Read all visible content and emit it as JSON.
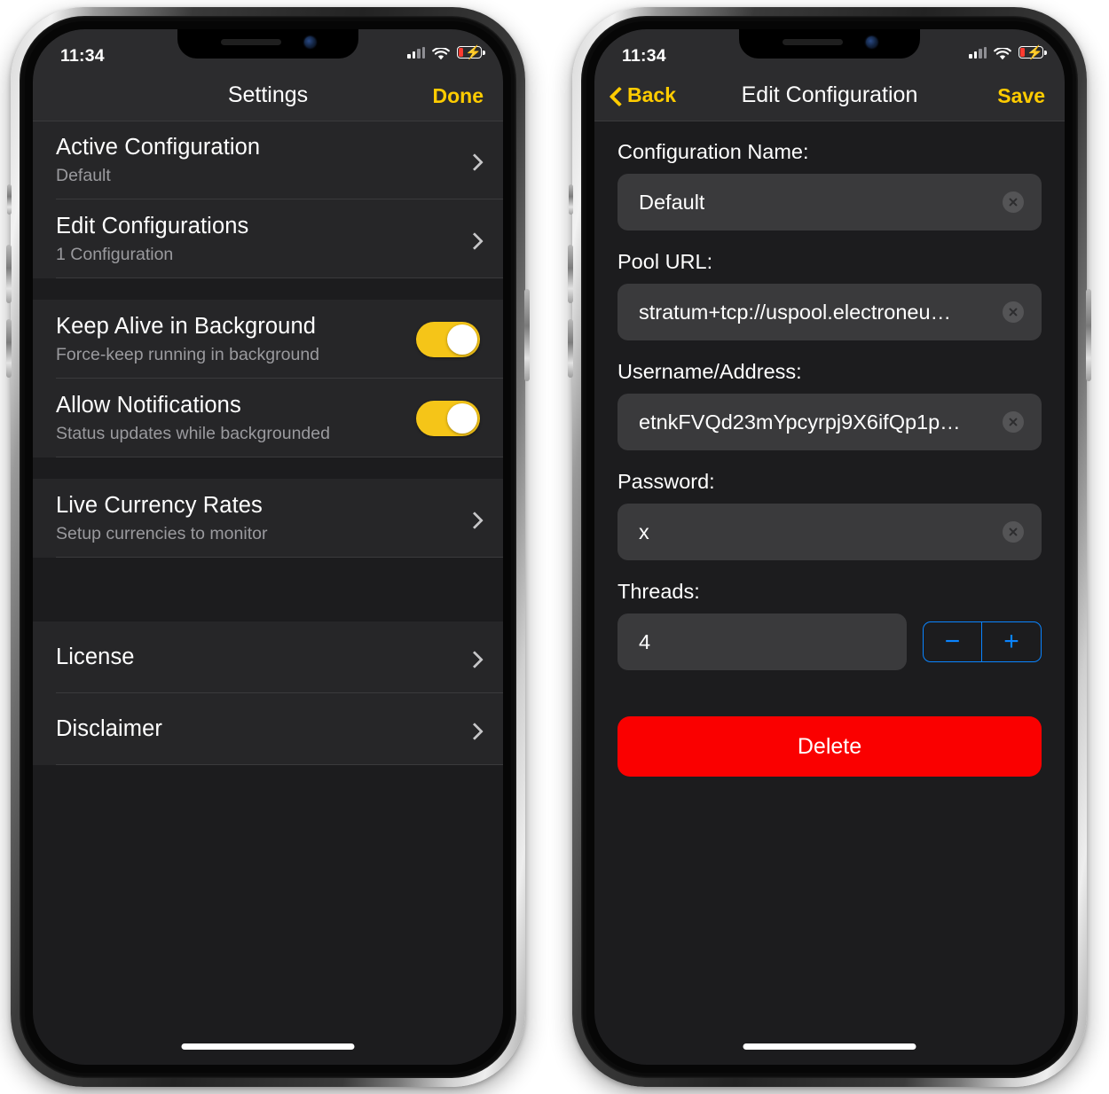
{
  "status_bar": {
    "time": "11:34",
    "cellular_icon": "signal-bars-icon",
    "wifi_icon": "wifi-icon",
    "battery_icon": "battery-charging-low-icon"
  },
  "colors": {
    "accent_yellow": "#FFCC00",
    "toggle_on": "#F5C518",
    "stepper_blue": "#0A84FF",
    "delete_red": "#FA0000",
    "screen_bg": "#1c1c1e",
    "row_bg": "#262628",
    "nav_bg": "#2c2c2e",
    "field_bg": "#3a3a3c"
  },
  "left_phone": {
    "nav": {
      "title": "Settings",
      "right_action": "Done"
    },
    "groups": [
      {
        "rows": [
          {
            "title": "Active Configuration",
            "subtitle": "Default",
            "accessory": "chevron"
          },
          {
            "title": "Edit Configurations",
            "subtitle": "1 Configuration",
            "accessory": "chevron"
          }
        ]
      },
      {
        "rows": [
          {
            "title": "Keep Alive in Background",
            "subtitle": "Force-keep running in background",
            "accessory": "toggle",
            "toggle_on": true
          },
          {
            "title": "Allow Notifications",
            "subtitle": "Status updates while backgrounded",
            "accessory": "toggle",
            "toggle_on": true
          }
        ]
      },
      {
        "rows": [
          {
            "title": "Live Currency Rates",
            "subtitle": "Setup currencies to monitor",
            "accessory": "chevron"
          }
        ]
      },
      {
        "rows": [
          {
            "title": "License",
            "subtitle": "",
            "accessory": "chevron"
          },
          {
            "title": "Disclaimer",
            "subtitle": "",
            "accessory": "chevron"
          }
        ]
      }
    ]
  },
  "right_phone": {
    "nav": {
      "back_label": "Back",
      "title": "Edit Configuration",
      "right_action": "Save"
    },
    "fields": [
      {
        "label": "Configuration Name:",
        "value": "Default",
        "clear_icon": "clear-circle-icon"
      },
      {
        "label": "Pool URL:",
        "value": "stratum+tcp://uspool.electroneu…",
        "clear_icon": "clear-circle-icon"
      },
      {
        "label": "Username/Address:",
        "value": "etnkFVQd23mYpcyrpj9X6ifQp1p…",
        "clear_icon": "clear-circle-icon"
      },
      {
        "label": "Password:",
        "value": "x",
        "clear_icon": "clear-circle-icon"
      },
      {
        "label": "Threads:",
        "value": "4",
        "clear_icon": ""
      }
    ],
    "stepper": {
      "decrement_label": "−",
      "increment_label": "+"
    },
    "delete_label": "Delete"
  }
}
